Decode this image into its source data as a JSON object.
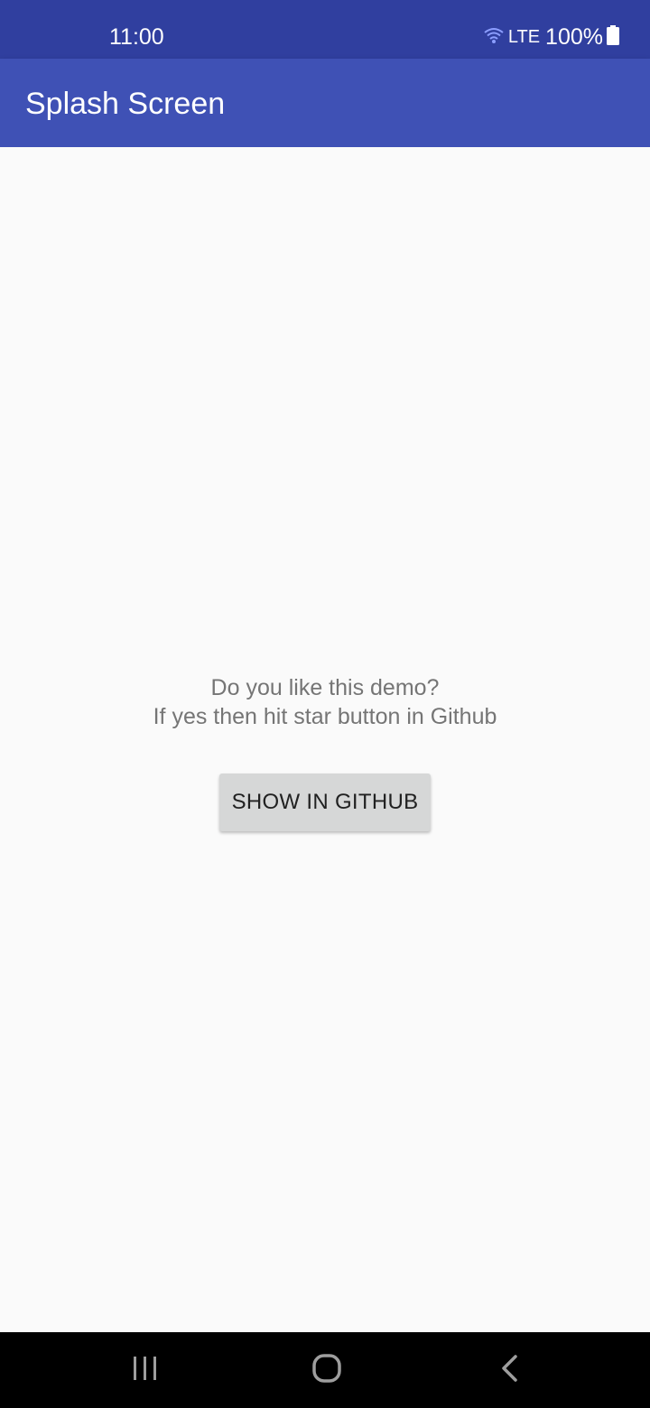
{
  "status_bar": {
    "time": "11:00",
    "network": "LTE",
    "battery": "100%",
    "icons": [
      "wifi-icon",
      "battery-icon"
    ]
  },
  "app_bar": {
    "title": "Splash Screen"
  },
  "main": {
    "message_line1": "Do you like this demo?",
    "message_line2": "If yes then hit star button in Github",
    "button_label": "SHOW IN GITHUB"
  },
  "nav_bar": {
    "icons": [
      "recent-apps-icon",
      "home-icon",
      "back-icon"
    ]
  },
  "colors": {
    "status_bar": "#303f9f",
    "app_bar": "#3f51b5",
    "background": "#fafafa",
    "button": "#d6d7d7",
    "message_text": "#757575"
  }
}
